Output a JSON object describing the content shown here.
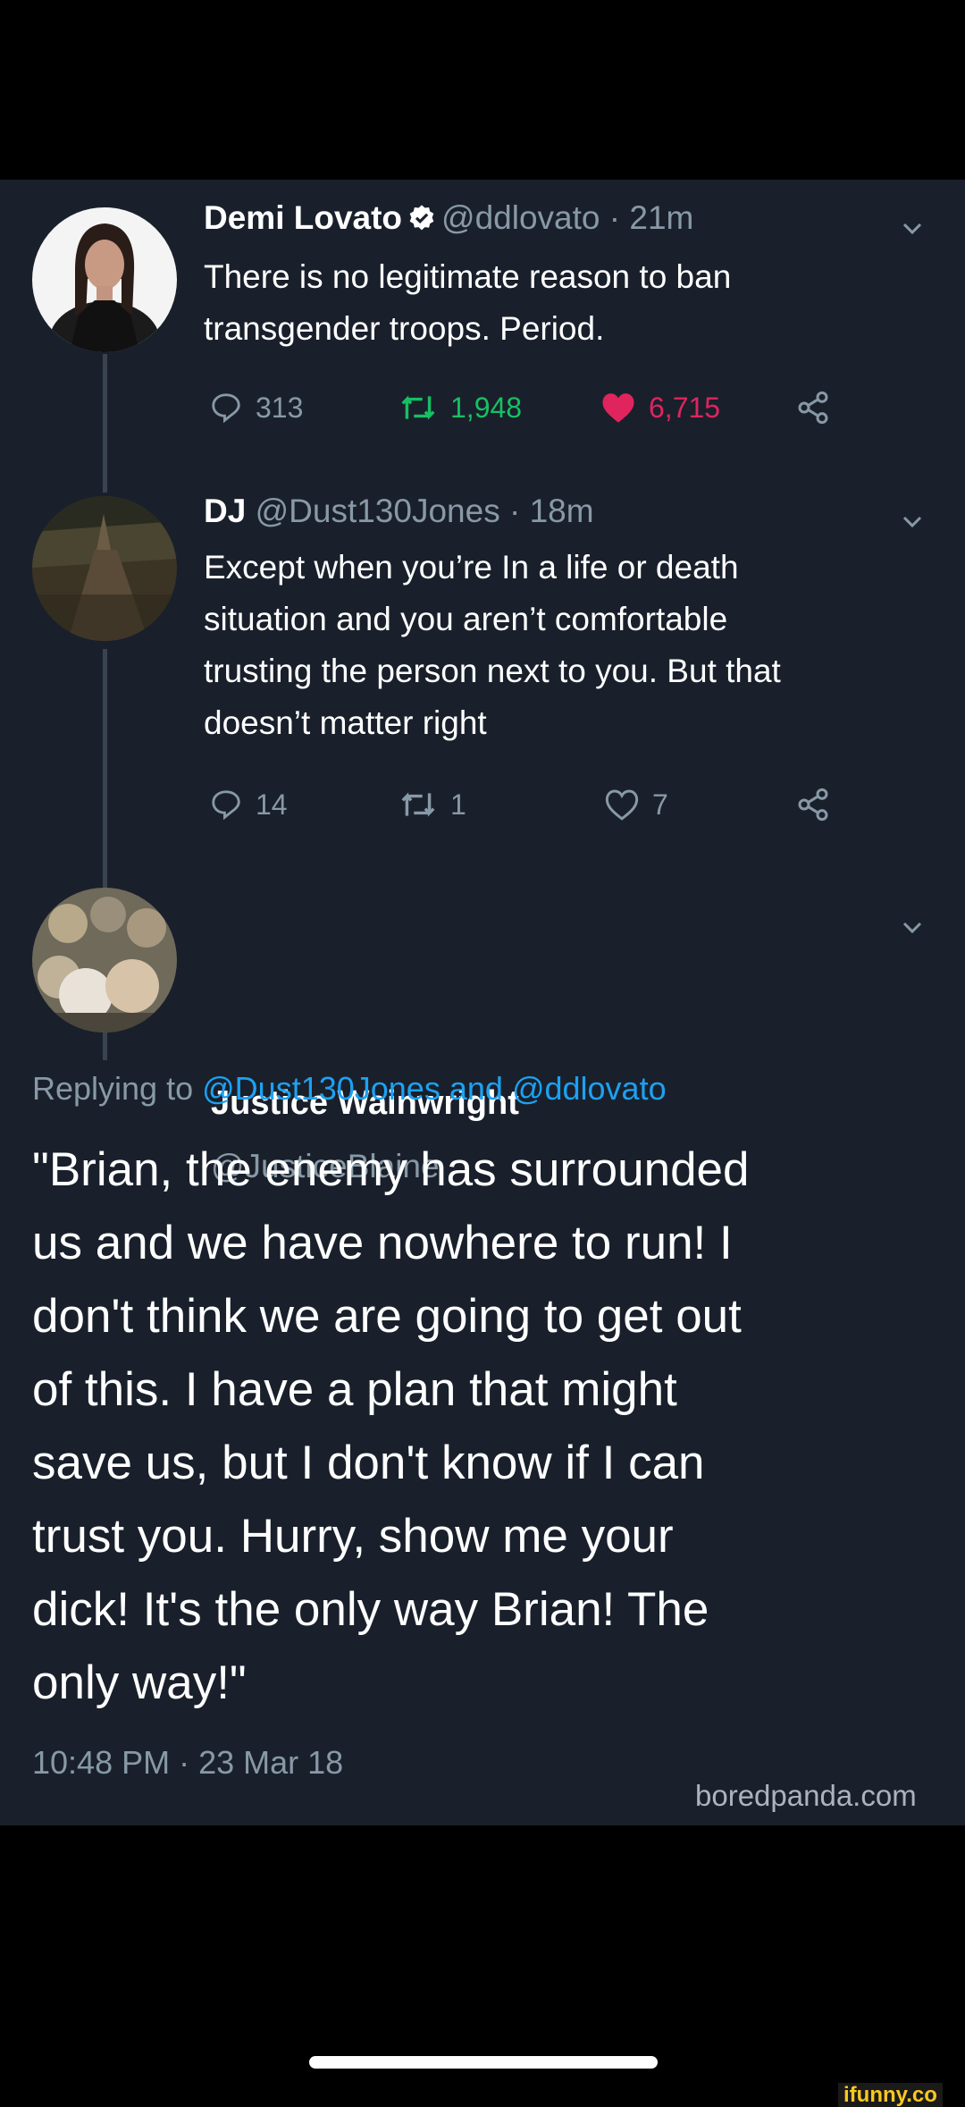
{
  "tweets": [
    {
      "display_name": "Demi Lovato",
      "verified": true,
      "handle_time": "@ddlovato · 21m",
      "text_lines": [
        "There is no legitimate reason to ban",
        "transgender troops. Period."
      ],
      "replies": "313",
      "retweets": "1,948",
      "likes": "6,715",
      "retweeted": true,
      "liked": true
    },
    {
      "display_name": "DJ",
      "verified": false,
      "handle_time": "@Dust130Jones · 18m",
      "text_lines": [
        "Except when you’re In a life or death",
        "situation and you aren’t comfortable",
        "trusting the person next to you. But that",
        "doesn’t matter right"
      ],
      "replies": "14",
      "retweets": "1",
      "likes": "7",
      "retweeted": false,
      "liked": false
    }
  ],
  "main_tweet": {
    "display_name": "Justice Wainwright",
    "handle": "@JusticeBlaine",
    "replying_prefix": "Replying to",
    "replying_to_1": "@Dust130Jones",
    "replying_and": "and",
    "replying_to_2": "@ddlovato",
    "text_lines": [
      "\"Brian, the enemy has surrounded",
      "us and we have nowhere to run! I",
      "don't think we are going to get out",
      "of this. I have a plan that might",
      "save us, but I don't know if I can",
      "trust you. Hurry, show me your",
      "dick! It's the only way Brian! The",
      "only way!\""
    ],
    "timestamp": "10:48 PM · 23 Mar 18"
  },
  "watermarks": {
    "boredpanda": "boredpanda.com",
    "ifunny": "ifunny.co"
  },
  "colors": {
    "card_background": "#19202b",
    "secondary_text": "#8899a6",
    "link": "#1da1f2",
    "retweet_active": "#17bf63",
    "like_active": "#e0245e",
    "verified_badge": "#ffffff"
  },
  "icons": [
    "verified-icon",
    "chevron-down-icon",
    "reply-icon",
    "retweet-icon",
    "heart-icon",
    "share-icon"
  ]
}
